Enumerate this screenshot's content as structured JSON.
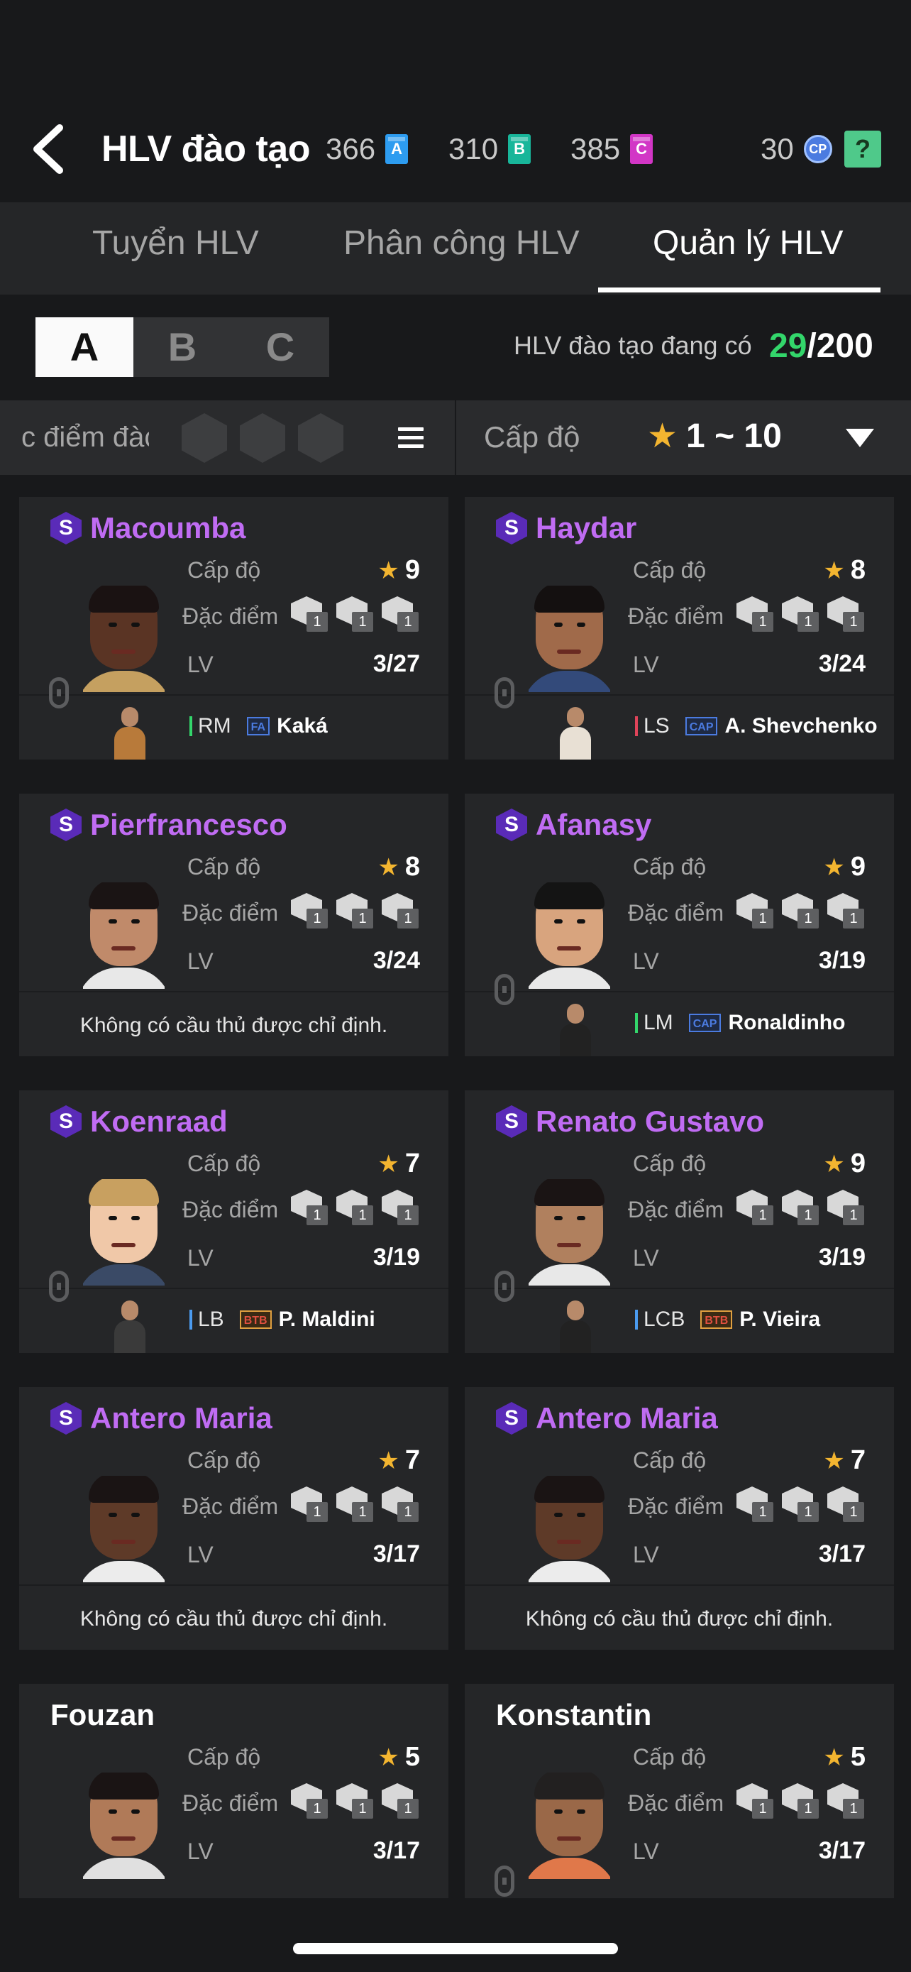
{
  "header": {
    "title": "HLV đào tạo",
    "resources": [
      {
        "value": "366",
        "letter": "A",
        "color": "#2d9cf0"
      },
      {
        "value": "310",
        "letter": "B",
        "color": "#18b69a"
      },
      {
        "value": "385",
        "letter": "C",
        "color": "#d236c6"
      }
    ],
    "cp": {
      "value": "30",
      "label": "CP"
    },
    "help": "?"
  },
  "tabs": [
    "Tuyển HLV",
    "Phân công HLV",
    "Quản lý HLV"
  ],
  "active_tab": 2,
  "grade_tabs": [
    "A",
    "B",
    "C"
  ],
  "active_grade": 0,
  "count": {
    "label": "HLV đào tạo đang có",
    "current": "29",
    "total": "/200"
  },
  "filter": {
    "trait_label": "c điểm đàc",
    "level_label": "Cấp độ",
    "level_range": "1 ~ 10"
  },
  "labels": {
    "level": "Cấp độ",
    "trait": "Đặc điểm",
    "lv": "LV",
    "no_player": "Không có cầu thủ được chỉ định.",
    "trait_count": "1"
  },
  "coaches": [
    {
      "name": "Macoumba",
      "special": "S",
      "stars": "9",
      "lv": "3/27",
      "assigned": {
        "pos": "RM",
        "pos_color": "#33d66b",
        "tag": "FA",
        "player": "Kaká"
      }
    },
    {
      "name": "Haydar",
      "special": "S",
      "stars": "8",
      "lv": "3/24",
      "assigned": {
        "pos": "LS",
        "pos_color": "#e0445a",
        "tag": "CAP",
        "player": "A. Shevchenko"
      }
    },
    {
      "name": "Pierfrancesco",
      "special": "S",
      "stars": "8",
      "lv": "3/24",
      "assigned": null
    },
    {
      "name": "Afanasy",
      "special": "S",
      "stars": "9",
      "lv": "3/19",
      "assigned": {
        "pos": "LM",
        "pos_color": "#33d66b",
        "tag": "CAP",
        "player": "Ronaldinho"
      }
    },
    {
      "name": "Koenraad",
      "special": "S",
      "stars": "7",
      "lv": "3/19",
      "assigned": {
        "pos": "LB",
        "pos_color": "#4b9bf0",
        "tag": "BTB",
        "player": "P. Maldini"
      }
    },
    {
      "name": "Renato Gustavo",
      "special": "S",
      "stars": "9",
      "lv": "3/19",
      "assigned": {
        "pos": "LCB",
        "pos_color": "#4b9bf0",
        "tag": "BTB",
        "player": "P. Vieira"
      }
    },
    {
      "name": "Antero Maria",
      "special": "S",
      "stars": "7",
      "lv": "3/17",
      "assigned": null
    },
    {
      "name": "Antero Maria",
      "special": "S",
      "stars": "7",
      "lv": "3/17",
      "assigned": null
    },
    {
      "name": "Fouzan",
      "special": "",
      "stars": "5",
      "lv": "3/17",
      "assigned": null
    },
    {
      "name": "Konstantin",
      "special": "",
      "stars": "5",
      "lv": "3/17",
      "assigned": null
    }
  ]
}
